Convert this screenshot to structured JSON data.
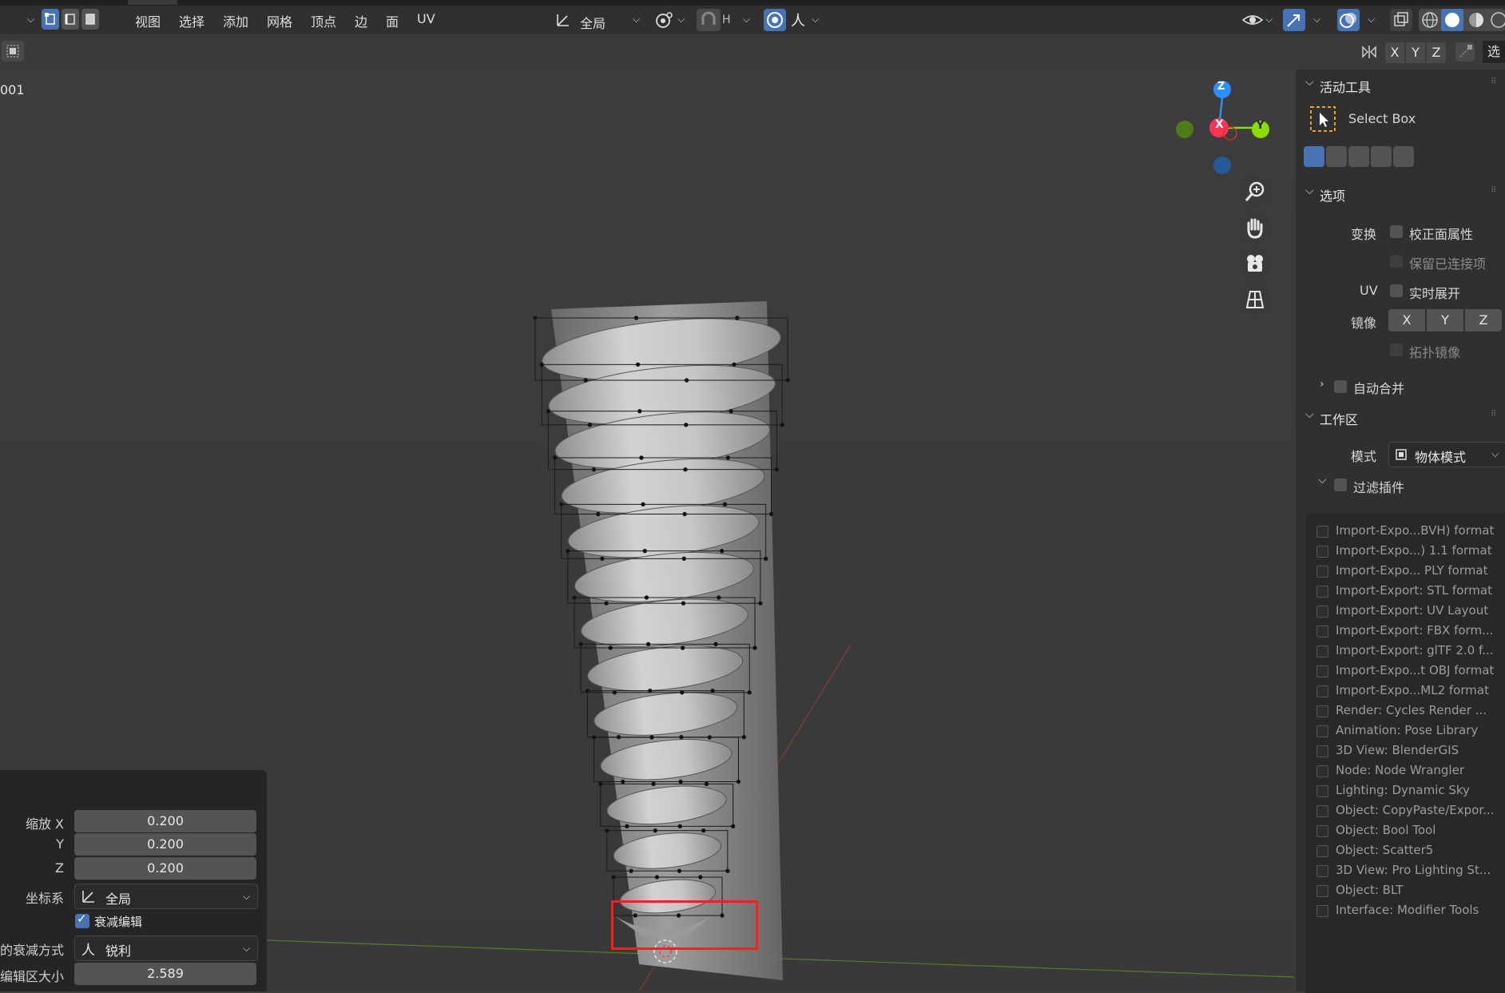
{
  "header": {
    "menus": [
      "视图",
      "选择",
      "添加",
      "网格",
      "顶点",
      "边",
      "面",
      "UV"
    ],
    "transform_orientation": "全局",
    "falloff_symbol": "人",
    "snap_label": "H"
  },
  "subbar": {
    "axes": [
      "X",
      "Y",
      "Z"
    ],
    "truncated_label": "选"
  },
  "viewport": {
    "object_label": "001",
    "gizmo": {
      "z": "Z",
      "x": "X",
      "y": "Y"
    }
  },
  "npanel": {
    "active_tool": {
      "title": "活动工具",
      "tool_name": "Select Box"
    },
    "options": {
      "title": "选项",
      "transform_label": "变换",
      "correct_face_attributes": "校正面属性",
      "keep_connected": "保留已连接项",
      "uv_label": "UV",
      "live_unwrap": "实时展开",
      "mirror_label": "镜像",
      "mirror_axes": [
        "X",
        "Y",
        "Z"
      ],
      "topology_mirror": "拓扑镜像",
      "auto_merge": "自动合并"
    },
    "workspace": {
      "title": "工作区",
      "mode_label": "模式",
      "mode_value": "物体模式",
      "filter_addons": "过滤插件"
    },
    "addons": [
      "Import-Expo...BVH) format",
      "Import-Expo...) 1.1 format",
      "Import-Expo... PLY format",
      "Import-Export: STL format",
      "Import-Export: UV Layout",
      "Import-Export: FBX form...",
      "Import-Export: glTF 2.0 f...",
      "Import-Expo...t OBJ format",
      "Import-Expo...ML2 format",
      "Render: Cycles Render ...",
      "Animation: Pose Library",
      "3D View: BlenderGIS",
      "Node: Node Wrangler",
      "Lighting: Dynamic Sky",
      "Object: CopyPaste/Expor...",
      "Object: Bool Tool",
      "Object: Scatter5",
      "3D View: Pro Lighting St...",
      "Object: BLT",
      "Interface: Modifier Tools"
    ]
  },
  "operator": {
    "scale_x_label": "缩放 X",
    "scale_x": "0.200",
    "y_label": "Y",
    "scale_y": "0.200",
    "z_label": "Z",
    "scale_z": "0.200",
    "orient_label": "坐标系",
    "orient_value": "全局",
    "proportional_label": "衰减编辑",
    "falloff_label": "的衰减方式",
    "falloff_value": "锐利",
    "falloff_symbol": "人",
    "size_label": "编辑区大小",
    "size_value": "2.589"
  },
  "colors": {
    "accent": "#4772b3",
    "annotation_red": "#ff1e1e",
    "axis_x": "#ff3352",
    "axis_y": "#8bdc00",
    "axis_z": "#2890ff"
  }
}
